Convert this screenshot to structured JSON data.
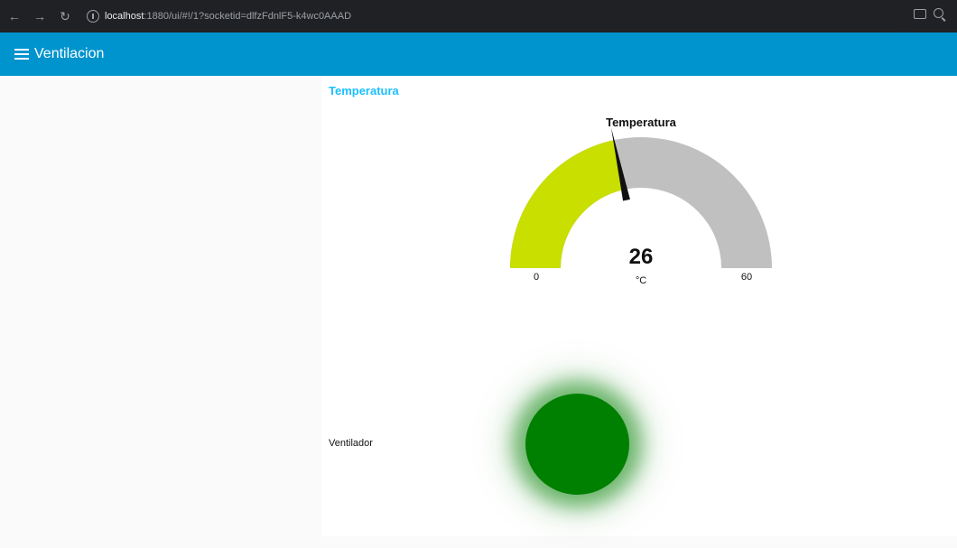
{
  "browser": {
    "url_host": "localhost",
    "url_path": ":1880/ui/#!/1?socketid=dlfzFdnlF5-k4wc0AAAD",
    "back_icon": "arrow-left-icon",
    "forward_icon": "arrow-right-icon",
    "reload_icon": "reload-icon",
    "info_icon": "info-icon",
    "cast_icon": "cast-icon",
    "zoom_icon": "zoom-icon"
  },
  "toolbar": {
    "title": "Ventilacion",
    "color": "#0094ce"
  },
  "group": {
    "title": "Temperatura"
  },
  "gauge": {
    "title": "Temperatura",
    "value": "26",
    "unit": "°C",
    "min": 0,
    "max": 60,
    "min_label": "0",
    "max_label": "60",
    "fill_color": "#c8df00",
    "track_color": "#c0c0c0"
  },
  "ventilador": {
    "label": "Ventilador",
    "led_color": "#008000",
    "on": true
  }
}
